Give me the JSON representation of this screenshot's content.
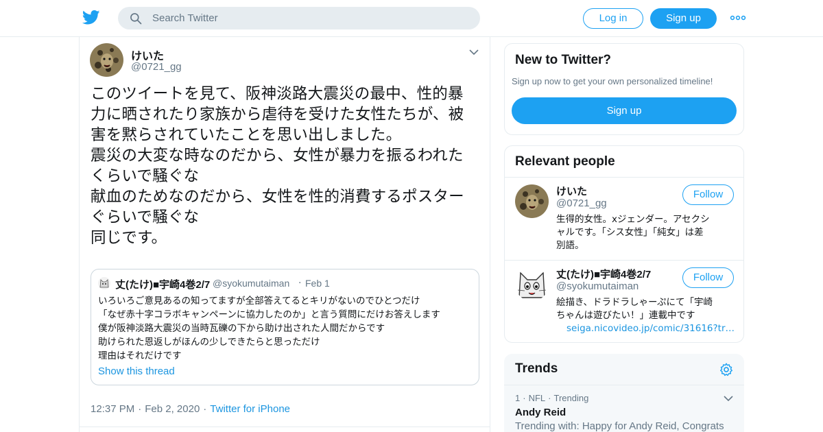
{
  "colors": {
    "brand": "#1da1f2",
    "link": "#1b95e0",
    "muted": "#657786",
    "text": "#14171a"
  },
  "header": {
    "logo_icon": "twitter-bird-icon",
    "search_placeholder": "Search Twitter",
    "login_label": "Log in",
    "signup_label": "Sign up",
    "more_icon": "more-dots-icon"
  },
  "tweet": {
    "author_name": "けいた",
    "author_handle": "@0721_gg",
    "text_lines": [
      "このツイートを見て、阪神淡路大震災の最中、性的暴",
      "力に晒されたり家族から虐待を受けた女性たちが、被",
      "害を黙らされていたことを思い出しました。",
      "震災の大変な時なのだから、女性が暴力を振るわれた",
      "くらいで騒ぐな",
      "献血のためなのだから、女性を性的消費するポスター",
      "ぐらいで騒ぐな",
      "同じです。"
    ],
    "quote": {
      "name": "丈(たけ)■宇崎4巻2/7",
      "handle": "@syokumutaiman",
      "date": "Feb 1",
      "lines": [
        "いろいろご意見あるの知ってますが全部答えてるとキリがないのでひとつだけ",
        "「なぜ赤十字コラボキャンペーンに協力したのか」と言う質問にだけお答えします",
        "僕が阪神淡路大震災の当時瓦礫の下から助け出された人間だからです",
        "助けられた恩返しがほんの少しできたらと思っただけ",
        "理由はそれだけです"
      ],
      "show_thread": "Show this thread"
    },
    "time": "12:37 PM",
    "date": "Feb 2, 2020",
    "source": "Twitter for iPhone"
  },
  "sidebar": {
    "new_to_twitter": {
      "title": "New to Twitter?",
      "subtitle": "Sign up now to get your own personalized timeline!",
      "button": "Sign up"
    },
    "relevant": {
      "title": "Relevant people",
      "people": [
        {
          "name": "けいた",
          "handle": "@0721_gg",
          "follow": "Follow",
          "bio_lines": [
            "生得的女性。xジェンダー。アセクシ",
            "ャルです。「シス女性」「純女」は差",
            "別語。"
          ]
        },
        {
          "name": "丈(たけ)■宇崎4巻2/7",
          "handle": "@syokumutaiman",
          "follow": "Follow",
          "bio_lines": [
            "絵描き、ドラドラしゃーぷにて「宇崎",
            "ちゃんは遊びたい！」連載中です"
          ],
          "link": "seiga.nicovideo.jp/comic/31616?tr…"
        }
      ]
    },
    "trends": {
      "title": "Trends",
      "items": [
        {
          "rank": "1",
          "category": "NFL",
          "label": "Trending",
          "name": "Andy Reid",
          "with": "Trending with: Happy for Andy Reid, Congrats"
        }
      ]
    }
  }
}
